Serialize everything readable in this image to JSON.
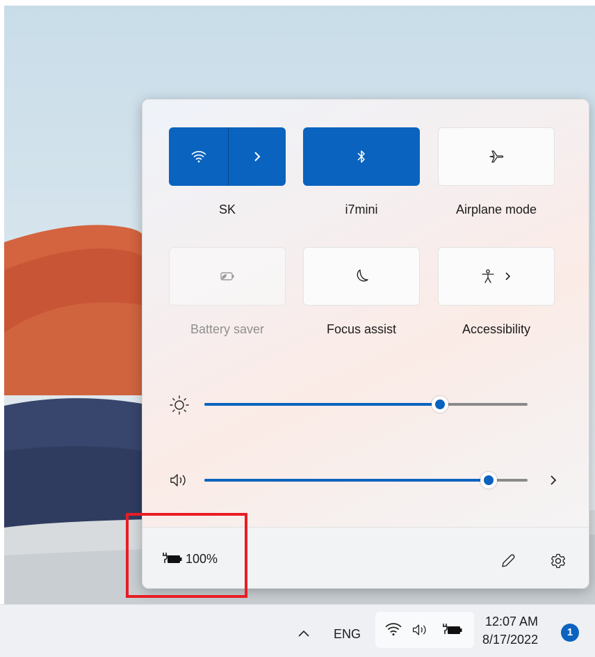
{
  "quick_settings": {
    "tiles": [
      {
        "label": "SK",
        "icon": "wifi-icon",
        "state": "on",
        "has_expand": true
      },
      {
        "label": "i7mini",
        "icon": "bluetooth-icon",
        "state": "on"
      },
      {
        "label": "Airplane mode",
        "icon": "airplane-icon",
        "state": "off"
      },
      {
        "label": "Battery saver",
        "icon": "battery-saver-icon",
        "state": "disabled"
      },
      {
        "label": "Focus assist",
        "icon": "moon-icon",
        "state": "off"
      },
      {
        "label": "Accessibility",
        "icon": "accessibility-icon",
        "state": "off",
        "has_expand": true
      }
    ],
    "brightness": {
      "icon": "brightness-icon",
      "level_percent": 73
    },
    "volume": {
      "icon": "volume-icon",
      "level_percent": 88
    }
  },
  "footer": {
    "battery_icon": "battery-charging-icon",
    "battery_text": "100%",
    "edit_icon": "pencil-icon",
    "settings_icon": "settings-gear-icon"
  },
  "taskbar": {
    "overflow_icon": "chevron-up-icon",
    "language": "ENG",
    "tray_icons": [
      "wifi-icon",
      "volume-icon",
      "battery-charging-icon"
    ],
    "time": "12:07 AM",
    "date": "8/17/2022",
    "notification_count": "1"
  },
  "colors": {
    "accent": "#0a63be",
    "highlight_box": "#e81c24"
  }
}
